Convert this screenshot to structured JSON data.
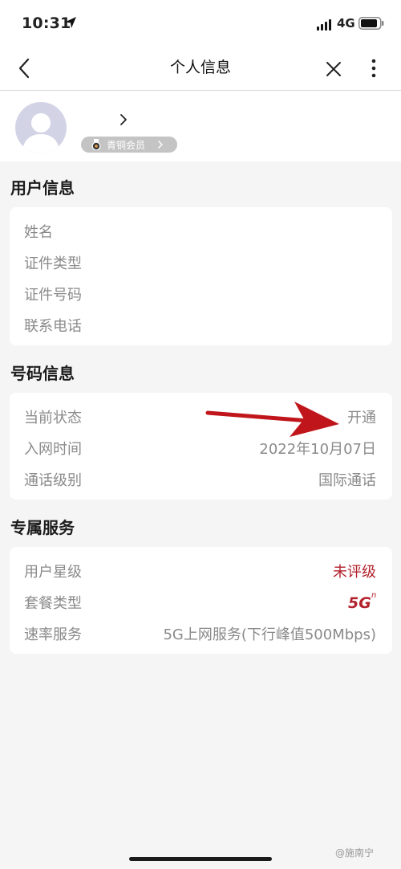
{
  "status_bar": {
    "time": "10:31",
    "network": "4G"
  },
  "nav": {
    "title": "个人信息"
  },
  "profile": {
    "chevron": "›",
    "member_label": "青铜会员"
  },
  "user_info": {
    "title": "用户信息",
    "rows": [
      {
        "label": "姓名"
      },
      {
        "label": "证件类型"
      },
      {
        "label": "证件号码"
      },
      {
        "label": "联系电话"
      }
    ]
  },
  "number_info": {
    "title": "号码信息",
    "rows": [
      {
        "label": "当前状态",
        "value": "开通"
      },
      {
        "label": "入网时间",
        "value": "2022年10月07日"
      },
      {
        "label": "通话级别",
        "value": "国际通话"
      }
    ]
  },
  "exclusive_service": {
    "title": "专属服务",
    "rows": [
      {
        "label": "用户星级",
        "value": "未评级"
      },
      {
        "label": "套餐类型",
        "value_logo": "5G"
      },
      {
        "label": "速率服务",
        "value": "5G上网服务(下行峰值500Mbps)"
      }
    ]
  },
  "watermark": "@施南宁",
  "colors": {
    "accent_red": "#b3212c",
    "annotation_red": "#c0161b",
    "badge_gray": "#c4c4c4"
  }
}
